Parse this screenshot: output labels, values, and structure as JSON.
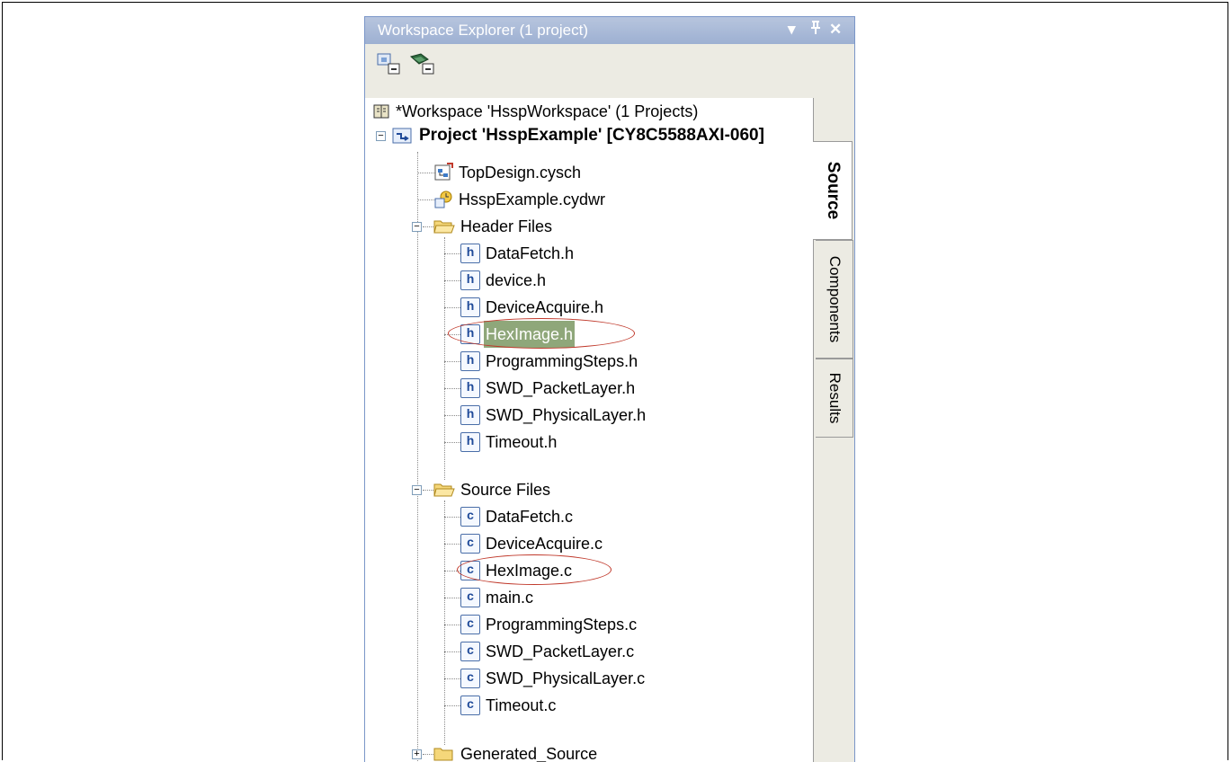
{
  "panel": {
    "title": "Workspace Explorer (1 project)",
    "controls": {
      "dropdown": "▾",
      "pin": "ᵖ",
      "close": "✕"
    }
  },
  "toolbar": {
    "buttons": [
      "show-dependencies-icon",
      "hide-dependencies-icon"
    ]
  },
  "tree": {
    "workspace": "*Workspace 'HsspWorkspace' (1 Projects)",
    "project": "Project 'HsspExample' [CY8C5588AXI-060]",
    "top_items": [
      "TopDesign.cysch",
      "HsspExample.cydwr"
    ],
    "header_folder": "Header Files",
    "header_files": [
      "DataFetch.h",
      "device.h",
      "DeviceAcquire.h",
      "HexImage.h",
      "ProgrammingSteps.h",
      "SWD_PacketLayer.h",
      "SWD_PhysicalLayer.h",
      "Timeout.h"
    ],
    "source_folder": "Source Files",
    "source_files": [
      "DataFetch.c",
      "DeviceAcquire.c",
      "HexImage.c",
      "main.c",
      "ProgrammingSteps.c",
      "SWD_PacketLayer.c",
      "SWD_PhysicalLayer.c",
      "Timeout.c"
    ],
    "generated_folder": "Generated_Source",
    "selected_item": "HexImage.h",
    "highlighted_items": [
      "HexImage.h",
      "HexImage.c"
    ]
  },
  "tabs": [
    "Source",
    "Components",
    "Results"
  ],
  "active_tab": "Source",
  "icons": {
    "h_file": "h",
    "c_file": "c"
  },
  "colors": {
    "title_bar": "#a8b9d8",
    "selection": "#8fa77a",
    "annotation_oval": "#c0392b",
    "file_icon": "#1f4a99"
  }
}
